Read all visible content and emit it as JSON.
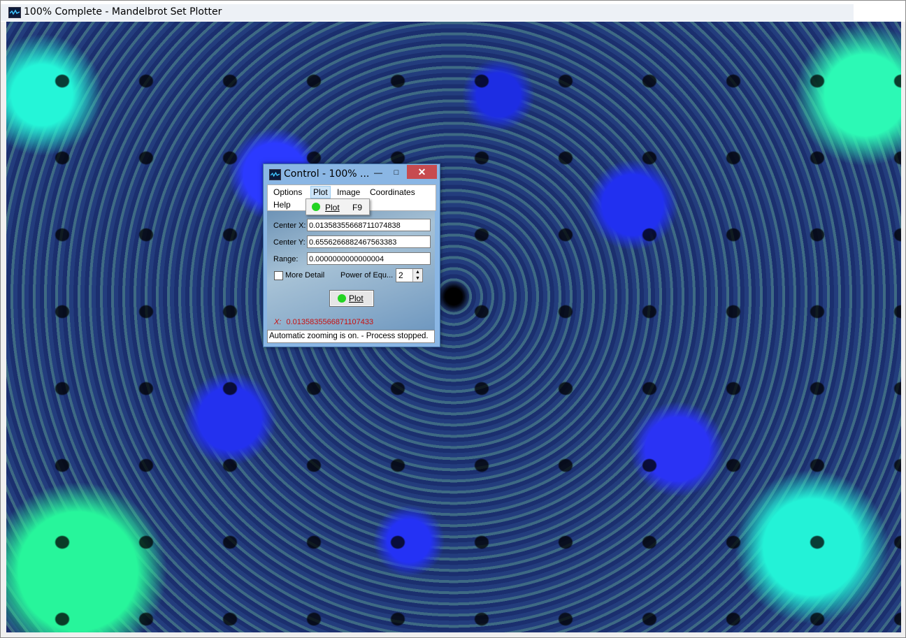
{
  "main_window": {
    "title": "100% Complete - Mandelbrot Set Plotter"
  },
  "control_dialog": {
    "title": "Control - 100% ...",
    "min_glyph": "—",
    "max_glyph": "□",
    "close_glyph": "✕",
    "menu": {
      "options": "Options",
      "plot": "Plot",
      "image": "Image",
      "coordinates": "Coordinates",
      "help": "Help"
    },
    "plot_menu_dropdown": {
      "item_label": "Plot",
      "shortcut": "F9"
    },
    "fields": {
      "center_x_label": "Center X:",
      "center_x_value": "0.0135835566871107483​8",
      "center_y_label": "Center Y:",
      "center_y_value": "0.6556266882467563383",
      "range_label": "Range:",
      "range_value": "0.0000000000000004"
    },
    "more_detail_label": "More Detail",
    "power_label": "Power of Equ...",
    "power_value": "2",
    "plot_button_label": "Plot",
    "coordinate_readout_label": "X:",
    "coordinate_readout_value": "0.0135835566871107433",
    "status_text": "Automatic zooming is on. - Process stopped."
  },
  "colors": {
    "close_button": "#c74b50",
    "plot_dot": "#22d422",
    "coordinate_text": "#c81010"
  }
}
